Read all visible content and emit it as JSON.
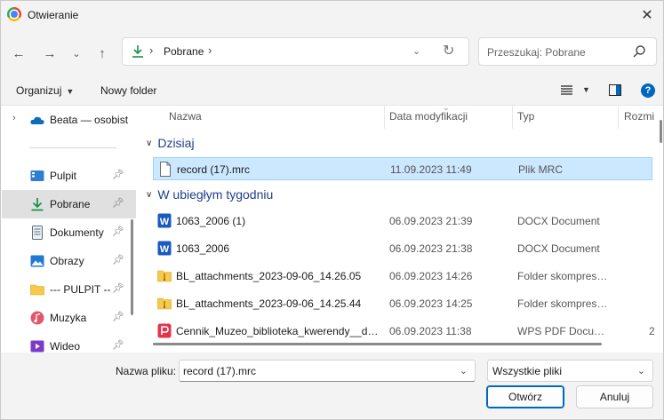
{
  "window": {
    "title": "Otwieranie"
  },
  "address": {
    "crumb": "Pobrane"
  },
  "search": {
    "placeholder": "Przeszukaj: Pobrane"
  },
  "commands": {
    "organize": "Organizuj",
    "new_folder": "Nowy folder"
  },
  "sidebar": {
    "items": [
      {
        "label": "Beata — osobist",
        "icon": "onedrive-cloud-icon"
      },
      {
        "label": "Pulpit",
        "icon": "desktop-icon"
      },
      {
        "label": "Pobrane",
        "icon": "download-icon"
      },
      {
        "label": "Dokumenty",
        "icon": "documents-icon"
      },
      {
        "label": "Obrazy",
        "icon": "pictures-icon"
      },
      {
        "label": "--- PULPIT --",
        "icon": "folder-icon"
      },
      {
        "label": "Muzyka",
        "icon": "music-icon"
      },
      {
        "label": "Wideo",
        "icon": "video-icon"
      }
    ]
  },
  "columns": {
    "name": "Nazwa",
    "date": "Data modyfikacji",
    "type": "Typ",
    "size": "Rozmi"
  },
  "groups": {
    "today": "Dzisiaj",
    "last_week": "W ubiegłym tygodniu"
  },
  "files": [
    {
      "name": "record (17).mrc",
      "date": "11.09.2023 11:49",
      "type": "Plik MRC",
      "icon": "generic-file-icon"
    },
    {
      "name": "1063_2006 (1)",
      "date": "06.09.2023 21:39",
      "type": "DOCX Document",
      "icon": "word-doc-icon"
    },
    {
      "name": "1063_2006",
      "date": "06.09.2023 21:38",
      "type": "DOCX Document",
      "icon": "word-doc-icon"
    },
    {
      "name": "BL_attachments_2023-09-06_14.26.05",
      "date": "06.09.2023 14:26",
      "type": "Folder skompreso...",
      "icon": "zip-folder-icon"
    },
    {
      "name": "BL_attachments_2023-09-06_14.25.44",
      "date": "06.09.2023 14:25",
      "type": "Folder skompreso...",
      "icon": "zip-folder-icon"
    },
    {
      "name": "Cennik_Muzeo_biblioteka_kwerendy__do...",
      "date": "06.09.2023 11:38",
      "type": "WPS PDF Docume...",
      "icon": "wps-pdf-icon"
    }
  ],
  "partial_size": "2",
  "bottom": {
    "filename_label": "Nazwa pliku:",
    "filename_value": "record (17).mrc",
    "filetype": "Wszystkie pliki",
    "open": "Otwórz",
    "cancel": "Anuluj"
  }
}
